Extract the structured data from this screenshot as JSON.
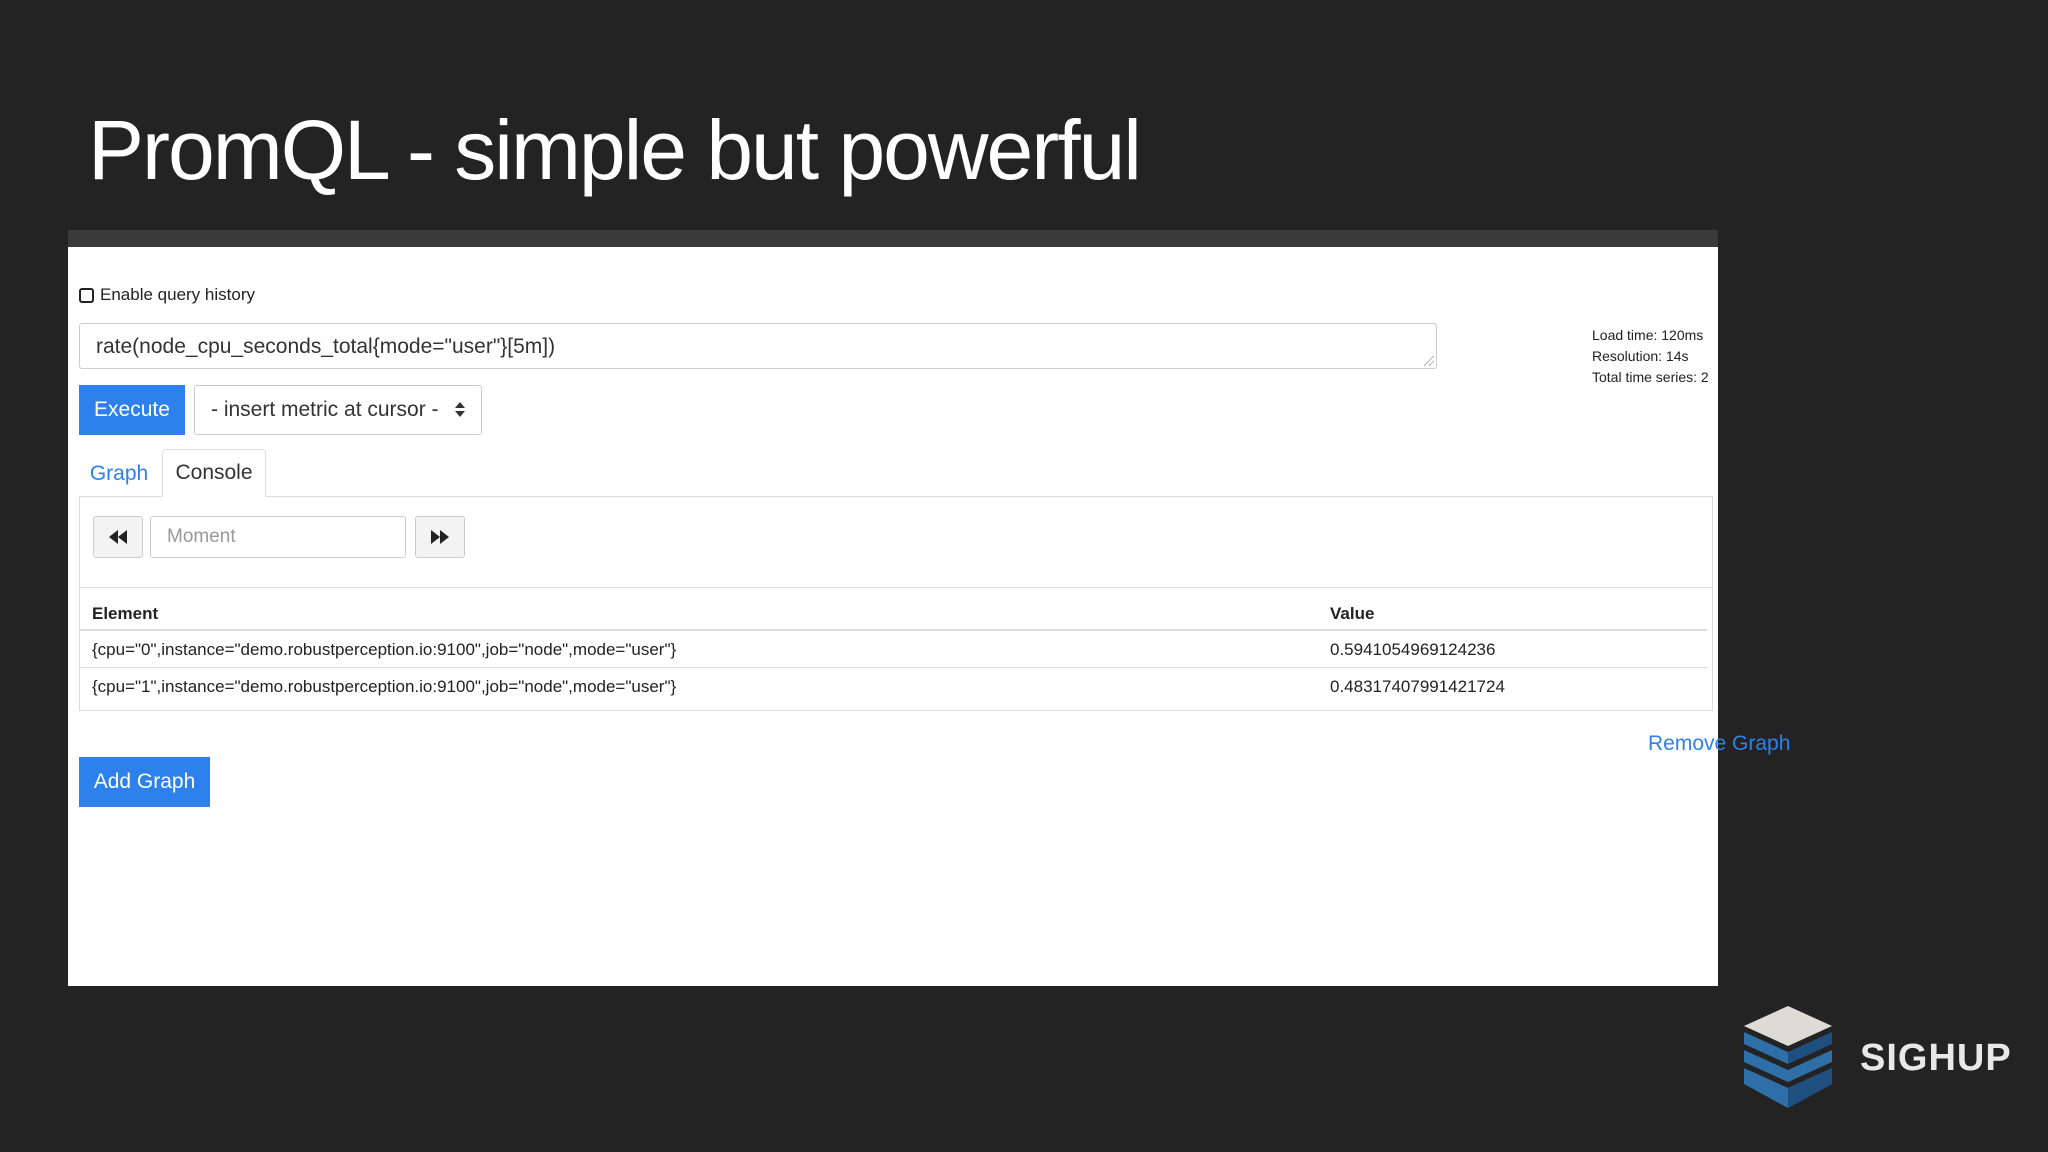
{
  "slide": {
    "title": "PromQL - simple but powerful"
  },
  "app": {
    "history_label": "Enable query history",
    "query": "rate(node_cpu_seconds_total{mode=\"user\"}[5m])",
    "stats": [
      "Load time: 120ms",
      "Resolution: 14s",
      "Total time series: 2"
    ],
    "execute_label": "Execute",
    "metric_select_label": "- insert metric at cursor -",
    "tabs": [
      {
        "label": "Graph"
      },
      {
        "label": "Console"
      }
    ],
    "moment_placeholder": "Moment",
    "table": {
      "headers": [
        "Element",
        "Value"
      ],
      "rows": [
        {
          "element": "{cpu=\"0\",instance=\"demo.robustperception.io:9100\",job=\"node\",mode=\"user\"}",
          "value": "0.5941054969124236"
        },
        {
          "element": "{cpu=\"1\",instance=\"demo.robustperception.io:9100\",job=\"node\",mode=\"user\"}",
          "value": "0.48317407991421724"
        }
      ]
    },
    "remove_graph_label": "Remove Graph",
    "add_graph_label": "Add Graph"
  },
  "brand": {
    "name": "SIGHUP"
  },
  "colors": {
    "accent": "#2e80ec",
    "slide_bg": "#232323",
    "logo_light": "#dcdcd4",
    "logo_blue": "#2f6fa8",
    "logo_blue_dark": "#1f4f7e"
  },
  "icons": {
    "prev": "fast-backward-icon",
    "next": "fast-forward-icon",
    "select": "select-arrows-icon"
  }
}
